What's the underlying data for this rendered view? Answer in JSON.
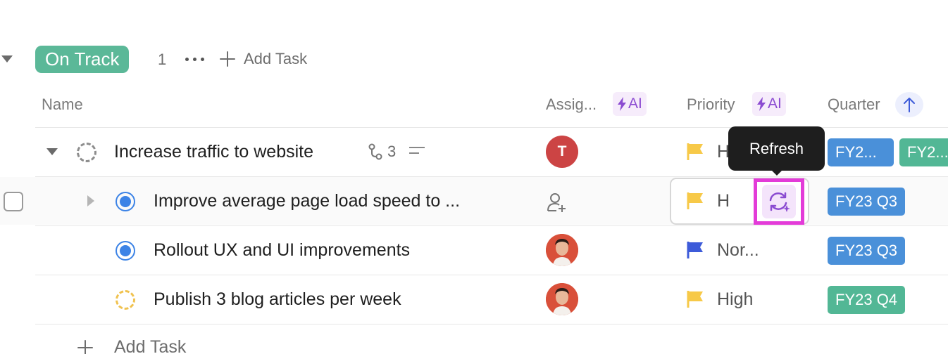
{
  "group": {
    "status_label": "On Track",
    "count": "1",
    "add_task_label": "Add Task"
  },
  "columns": {
    "name": "Name",
    "assignee": "Assig...",
    "priority": "Priority",
    "quarter": "Quarter",
    "ai_label": "AI"
  },
  "tooltip": {
    "text": "Refresh"
  },
  "rows": [
    {
      "name": "Increase traffic to website",
      "subtask_count": "3",
      "assignee_initial": "T",
      "priority": "H",
      "quarters": [
        "FY2...",
        "FY2..."
      ],
      "status": "in-progress"
    },
    {
      "name": "Improve average page load speed to ...",
      "priority": "H",
      "quarters": [
        "FY23 Q3"
      ],
      "status": "complete"
    },
    {
      "name": "Rollout UX and UI improvements",
      "priority": "Nor...",
      "quarters": [
        "FY23 Q3"
      ],
      "status": "complete"
    },
    {
      "name": "Publish 3 blog articles per week",
      "priority": "High",
      "quarters": [
        "FY23 Q4"
      ],
      "status": "to-do"
    }
  ],
  "footer": {
    "add_task_label": "Add Task"
  },
  "colors": {
    "on_track": "#5bb898",
    "quarter_blue": "#4a90d9",
    "quarter_green": "#52b795",
    "flag_high": "#f7c948",
    "flag_normal": "#3d5bd9",
    "ai_purple": "#8b4bd1",
    "highlight": "#e33bd8"
  }
}
